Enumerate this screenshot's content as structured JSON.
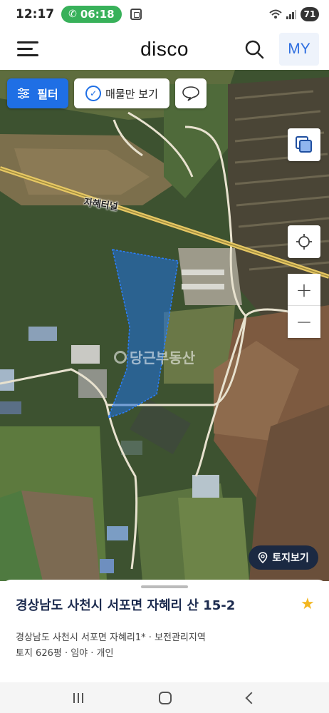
{
  "status_bar": {
    "time": "12:17",
    "call_timer": "06:18",
    "battery": "71"
  },
  "header": {
    "brand": "disco",
    "my_label": "MY"
  },
  "map": {
    "filter_label": "필터",
    "listing_only_label": "매물만 보기",
    "road_label": "자혜터널",
    "watermark": "당근부동산",
    "land_view_label": "토지보기"
  },
  "property": {
    "address": "경상남도 사천시 서포면 자혜리 산 15-2",
    "sub_address": "경상남도 사천시 서포면 자혜리1* · 보전관리지역",
    "details": "토지 626평 · 임야 · 개인"
  },
  "colors": {
    "accent": "#1f6fe5",
    "brand_nav": "#2f6fe0",
    "parcel_fill": "#1e6fe0",
    "star": "#f3b61f",
    "land_button": "#1b2942"
  },
  "icons": [
    "phone-icon",
    "screen-cast-icon",
    "wifi-icon",
    "signal-icon",
    "menu-icon",
    "search-icon",
    "filter-icon",
    "check-icon",
    "chat-bubble-icon",
    "layers-icon",
    "locate-icon",
    "location-pin-icon",
    "star-icon"
  ]
}
